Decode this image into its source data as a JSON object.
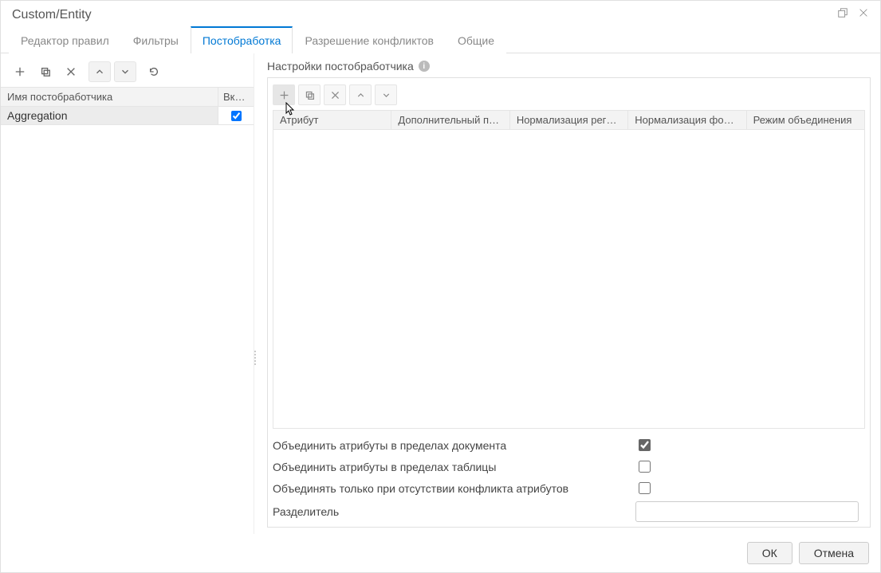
{
  "title": "Custom/Entity",
  "tabs": [
    {
      "label": "Редактор правил"
    },
    {
      "label": "Фильтры"
    },
    {
      "label": "Постобработка",
      "active": true
    },
    {
      "label": "Разрешение конфликтов"
    },
    {
      "label": "Общие"
    }
  ],
  "left": {
    "columns": {
      "name": "Имя постобработчика",
      "enabled": "Вкл…"
    },
    "rows": [
      {
        "name": "Aggregation",
        "enabled": true
      }
    ]
  },
  "right": {
    "title": "Настройки постобработчика",
    "columns": [
      "Атрибут",
      "Дополнительный п…",
      "Нормализация реги…",
      "Нормализация фор…",
      "Режим объединения"
    ],
    "options": {
      "merge_doc": {
        "label": "Объединить атрибуты в пределах документа",
        "value": true
      },
      "merge_table": {
        "label": "Объединить атрибуты в пределах таблицы",
        "value": false
      },
      "merge_no_conflict": {
        "label": "Объединять только при отсутствии конфликта атрибутов",
        "value": false
      },
      "delimiter": {
        "label": "Разделитель",
        "value": ""
      }
    }
  },
  "footer": {
    "ok": "ОК",
    "cancel": "Отмена"
  },
  "icons": {
    "maximize": "maximize-icon",
    "close": "close-icon",
    "add": "plus-icon",
    "copy": "copy-icon",
    "delete": "x-icon",
    "up": "chevron-up-icon",
    "down": "chevron-down-icon",
    "refresh": "refresh-icon",
    "info": "info-icon"
  }
}
